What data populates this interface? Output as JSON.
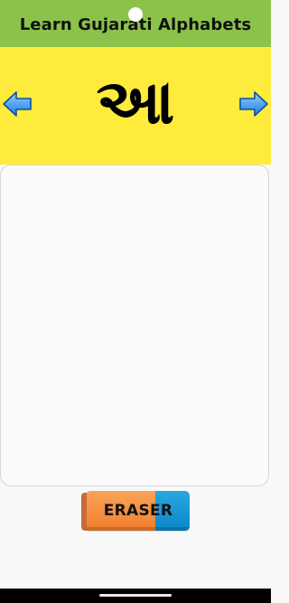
{
  "app": {
    "title": "Learn Gujarati Alphabets"
  },
  "letter_bar": {
    "current_letter": "આ",
    "background_color": "#ffeb3b",
    "prev_icon": "left-arrow-icon",
    "next_icon": "right-arrow-icon"
  },
  "header": {
    "background_color": "#8bc34a"
  },
  "drawing_area": {
    "background_color": "#fafafa"
  },
  "eraser": {
    "label": "ERASER",
    "icon": "eraser-icon",
    "colors": {
      "left": "#ef7f2b",
      "right": "#0b87c9"
    }
  }
}
